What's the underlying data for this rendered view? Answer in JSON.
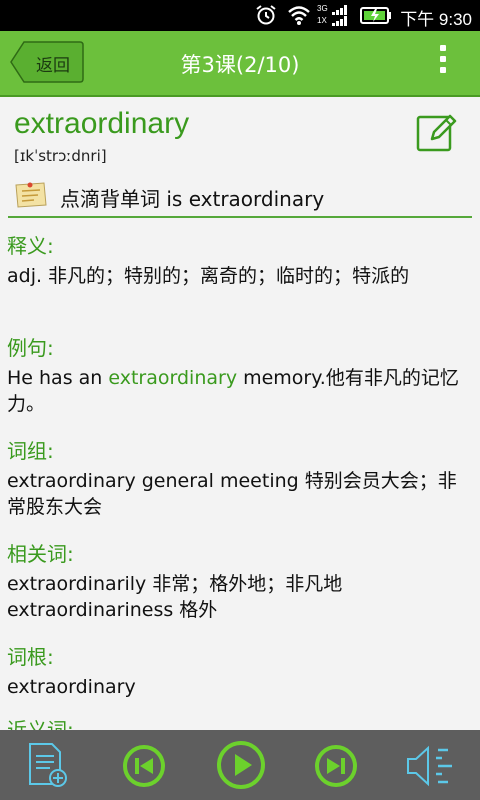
{
  "status": {
    "time": "下午 9:30",
    "net1": "3G",
    "net2": "1X"
  },
  "header": {
    "back_label": "返回",
    "title": "第3课(2/10)"
  },
  "word": {
    "text": "extraordinary",
    "phonetic": "[ɪkˈstrɔːdnri]",
    "note": "点滴背单词 is extraordinary"
  },
  "sections": {
    "definition": {
      "title": "释义:",
      "body": "adj. 非凡的；特别的；离奇的；临时的；特派的"
    },
    "example": {
      "title": "例句:",
      "pre": "He has an ",
      "highlight": "extraordinary",
      "post": " memory.他有非凡的记忆力。"
    },
    "phrase": {
      "title": "词组:",
      "body": "extraordinary general meeting 特别会员大会；非常股东大会"
    },
    "related": {
      "title": "相关词:",
      "line1": "extraordinarily 非常；格外地；非凡地",
      "line2": "extraordinariness 格外"
    },
    "root": {
      "title": "词根:",
      "body": "extraordinary"
    },
    "synonym": {
      "title": "近义词:"
    }
  },
  "toolbar": {
    "icons": [
      "add-note-icon",
      "previous-icon",
      "play-icon",
      "next-icon",
      "speaker-icon"
    ]
  },
  "colors": {
    "accent": "#6cc03c",
    "accent_text": "#3a9a1e",
    "toolbar": "#5e5e5e"
  }
}
